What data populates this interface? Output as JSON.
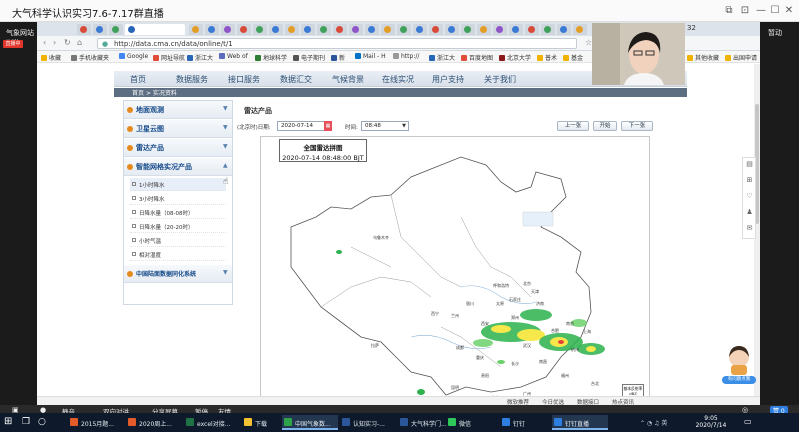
{
  "window": {
    "title": "大气科学认识实习7.6-7.17群直播",
    "controls": [
      "⧉",
      "⊡",
      "—",
      "☐",
      "✕"
    ]
  },
  "left_rail": {
    "label": "气象网站浏览",
    "live_badge": "直播中"
  },
  "right_rail": {
    "label": "暂动"
  },
  "browser": {
    "address": {
      "url": "http://data.cma.cn/data/online/t/1",
      "number": "32"
    },
    "bookmarks": [
      "收藏",
      "手机收藏夹",
      "Google",
      "网址导航",
      "浙江大",
      "Web of",
      "地球科学",
      "电子期刊",
      "新",
      "Mail - H",
      "http://",
      "浙江大",
      "百度地图",
      "北京大学",
      "普术",
      "基金",
      "其他收藏",
      "出国申请"
    ]
  },
  "site": {
    "nav": [
      "首页",
      "数据服务",
      "接口服务",
      "数据汇交",
      "气候背景",
      "在线实况",
      "用户支持",
      "关于我们"
    ],
    "breadcrumb": "首页 > 实况资料",
    "sidebar": {
      "sections": [
        {
          "label": "地面观测",
          "expanded": false
        },
        {
          "label": "卫星云图",
          "expanded": false
        },
        {
          "label": "雷达产品",
          "expanded": false
        },
        {
          "label": "智能网格实况产品",
          "expanded": true
        },
        {
          "label": "中国陆面数据同化系统",
          "expanded": false
        }
      ],
      "subitems": [
        "1小时降水",
        "3小时降水",
        "日降水量（08-08时）",
        "日降水量（20-20时）",
        "小时气温",
        "相对湿度"
      ]
    },
    "content": {
      "title": "雷达产品",
      "date_label": "(北京时)日期:",
      "date_value": "2020-07-14",
      "time_label": "时间:",
      "time_value": "08:48",
      "buttons": [
        "上一张",
        "开始",
        "下一张"
      ]
    },
    "map": {
      "title": "全国雷达拼图",
      "timestamp": "2020-07-14 08:48:00 BJT",
      "place_labels": [
        "乌鲁木齐",
        "呼和浩特",
        "北京",
        "天津",
        "石家庄",
        "太原",
        "银川",
        "兰州",
        "西宁",
        "西安",
        "郑州",
        "济南",
        "合肥",
        "南京",
        "上海",
        "武汉",
        "成都",
        "重庆",
        "长沙",
        "南昌",
        "杭州",
        "拉萨",
        "贵阳",
        "昆明",
        "南宁",
        "广州",
        "福州",
        "台北",
        "海口"
      ],
      "legend": [
        "基本反射率",
        "dBZ"
      ]
    },
    "status": [
      "微软推荐",
      "今日优选",
      "数据接口",
      "热点资讯"
    ]
  },
  "assistant": {
    "label": "有问题点我"
  },
  "ctrl_bar": {
    "items": [
      "静音",
      "双向对讲",
      "分享屏幕",
      "暂停",
      "友情"
    ]
  },
  "taskbar": {
    "items": [
      "2015月题...",
      "2020周上...",
      "excel对接...",
      "下载",
      "中国气象数...",
      "认知实习-...",
      "大气科学门...",
      "微信",
      "钉钉",
      "钉钉直播"
    ],
    "time": "9:05",
    "date": "2020/7/14"
  },
  "colors": {
    "accent": "#174b8a",
    "live": "#e0362c",
    "nav_text": "#2b4d72"
  }
}
